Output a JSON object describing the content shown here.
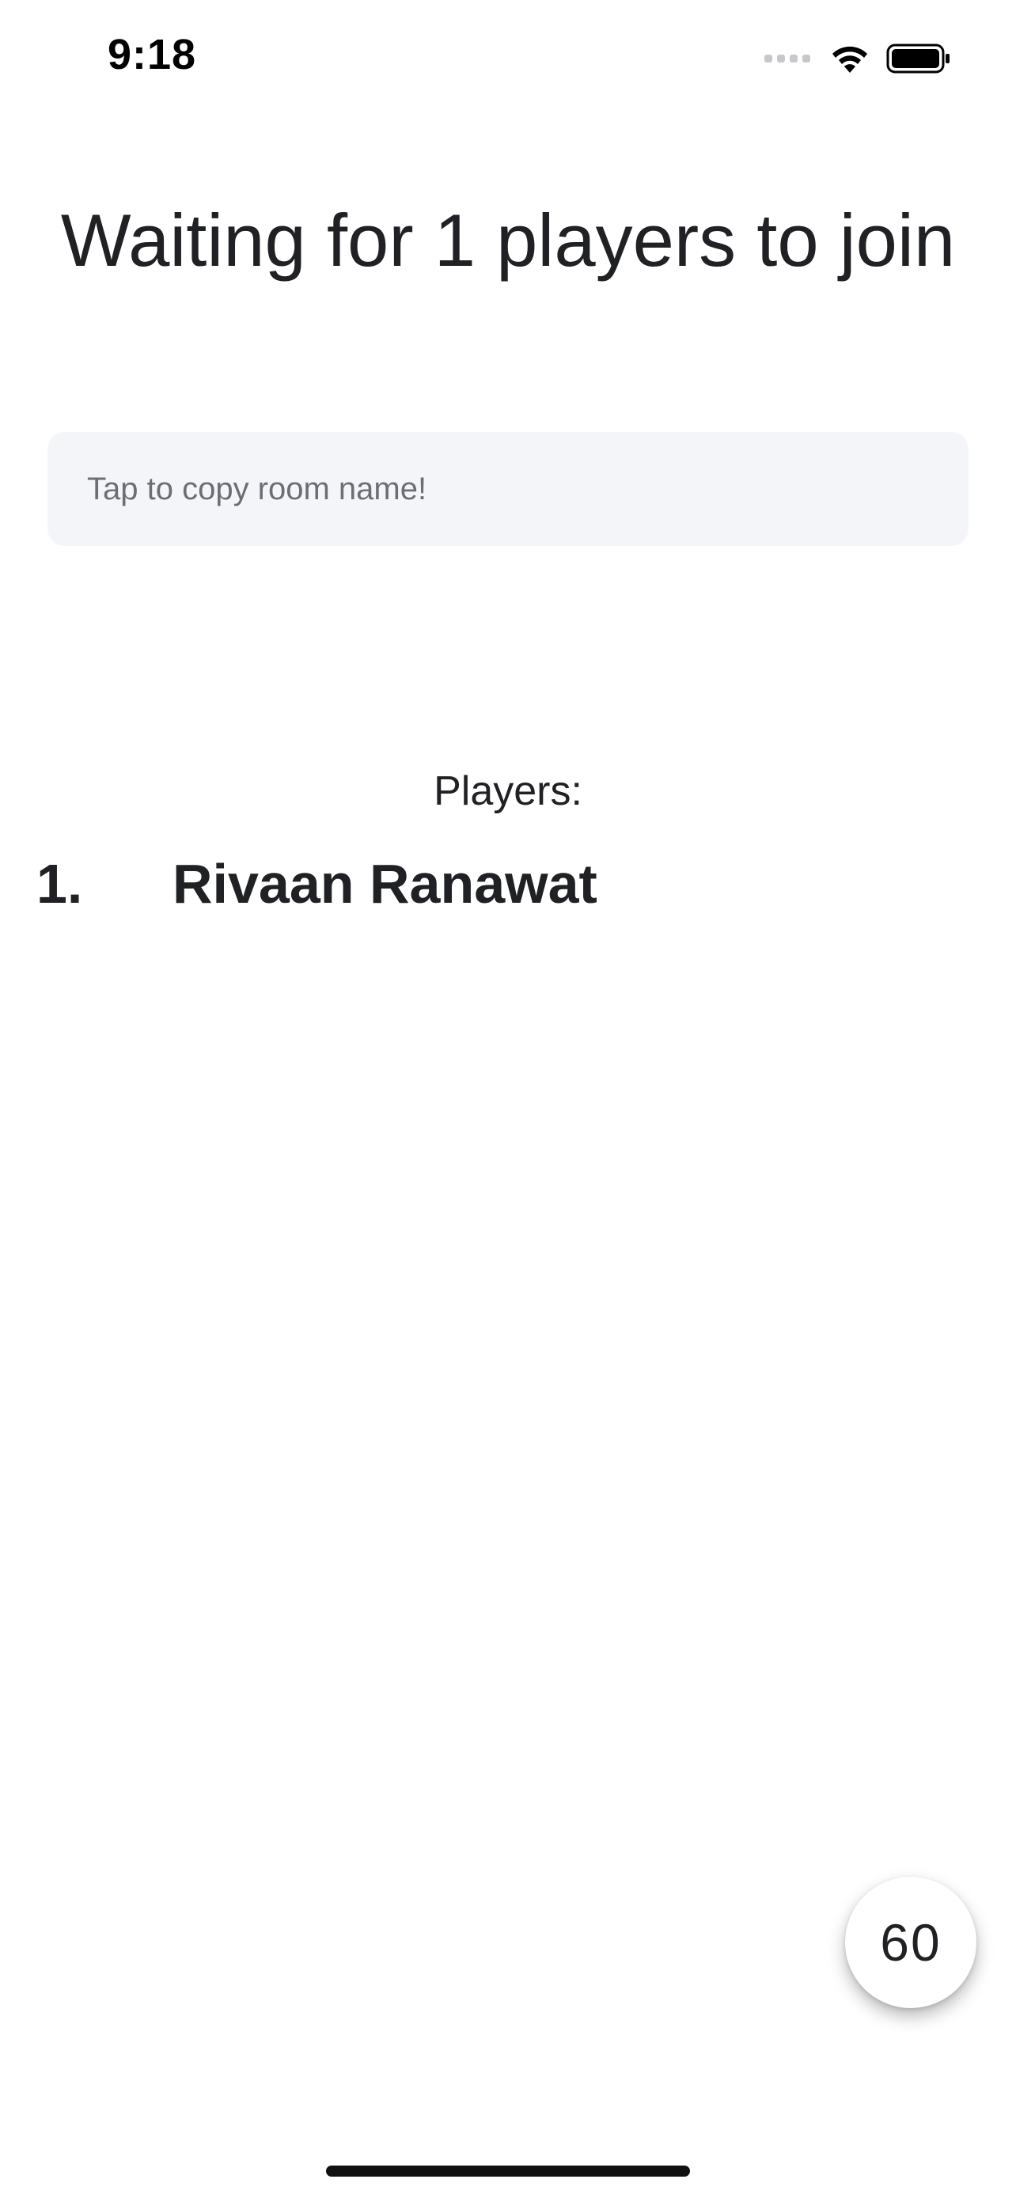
{
  "status_bar": {
    "time": "9:18",
    "icons": [
      "cellular-signal-icon",
      "wifi-icon",
      "battery-icon"
    ]
  },
  "title": "Waiting for 1 players to join",
  "room": {
    "copy_label": "Tap to copy room name!"
  },
  "players": {
    "heading": "Players:",
    "list": [
      {
        "index": "1.",
        "name": "Rivaan Ranawat"
      }
    ]
  },
  "countdown": {
    "value": "60"
  },
  "colors": {
    "background": "#ffffff",
    "text": "#202124",
    "field_background": "#f4f5f8",
    "field_text": "#6b6e75"
  }
}
